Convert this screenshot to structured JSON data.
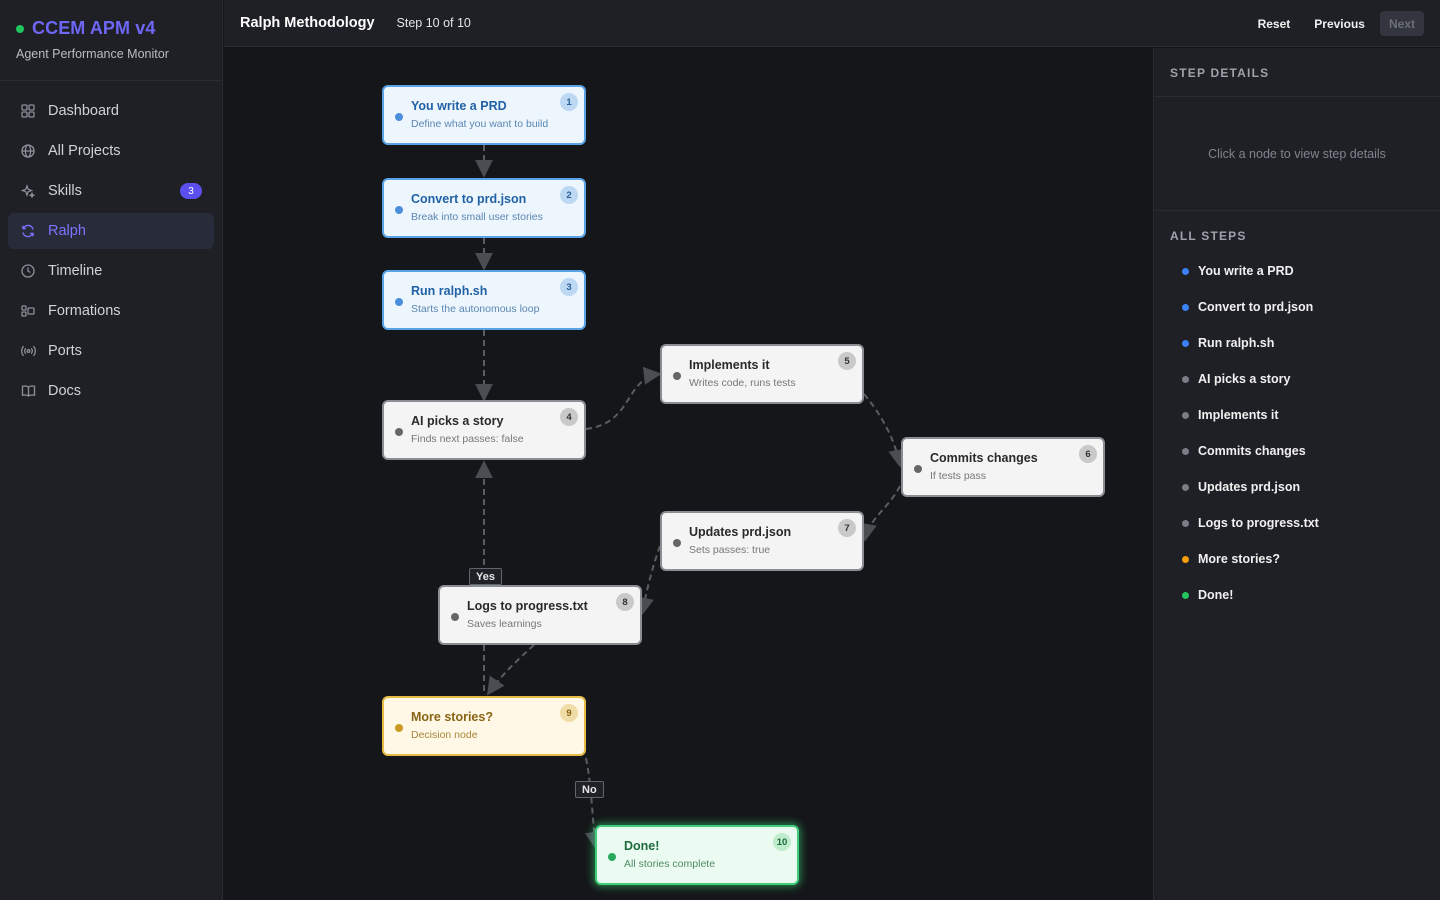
{
  "app": {
    "title": "CCEM APM v4",
    "subtitle": "Agent Performance Monitor",
    "status_color": "#22c55e"
  },
  "sidebar": {
    "items": [
      {
        "label": "Dashboard",
        "icon": "grid-icon",
        "active": false
      },
      {
        "label": "All Projects",
        "icon": "globe-icon",
        "active": false
      },
      {
        "label": "Skills",
        "icon": "sparkle-icon",
        "active": false,
        "badge": "3"
      },
      {
        "label": "Ralph",
        "icon": "refresh-icon",
        "active": true
      },
      {
        "label": "Timeline",
        "icon": "clock-icon",
        "active": false
      },
      {
        "label": "Formations",
        "icon": "formation-icon",
        "active": false
      },
      {
        "label": "Ports",
        "icon": "broadcast-icon",
        "active": false
      },
      {
        "label": "Docs",
        "icon": "book-icon",
        "active": false
      }
    ]
  },
  "header": {
    "title": "Ralph Methodology",
    "step": "Step 10 of 10",
    "reset_label": "Reset",
    "previous_label": "Previous",
    "next_label": "Next"
  },
  "flow": {
    "nodes": [
      {
        "num": "1",
        "title": "You write a PRD",
        "subtitle": "Define what you want to build",
        "variant": "blue"
      },
      {
        "num": "2",
        "title": "Convert to prd.json",
        "subtitle": "Break into small user stories",
        "variant": "blue"
      },
      {
        "num": "3",
        "title": "Run ralph.sh",
        "subtitle": "Starts the autonomous loop",
        "variant": "blue"
      },
      {
        "num": "4",
        "title": "AI picks a story",
        "subtitle": "Finds next passes: false",
        "variant": "gray"
      },
      {
        "num": "5",
        "title": "Implements it",
        "subtitle": "Writes code, runs tests",
        "variant": "gray"
      },
      {
        "num": "6",
        "title": "Commits changes",
        "subtitle": "If tests pass",
        "variant": "gray"
      },
      {
        "num": "7",
        "title": "Updates prd.json",
        "subtitle": "Sets passes: true",
        "variant": "gray"
      },
      {
        "num": "8",
        "title": "Logs to progress.txt",
        "subtitle": "Saves learnings",
        "variant": "gray"
      },
      {
        "num": "9",
        "title": "More stories?",
        "subtitle": "Decision node",
        "variant": "yellow"
      },
      {
        "num": "10",
        "title": "Done!",
        "subtitle": "All stories complete",
        "variant": "green"
      }
    ],
    "edge_labels": {
      "yes": "Yes",
      "no": "No"
    }
  },
  "panel": {
    "details_title": "STEP DETAILS",
    "details_placeholder": "Click a node to view step details",
    "steps_title": "ALL STEPS",
    "steps": [
      {
        "label": "You write a PRD",
        "color": "#3b82f6"
      },
      {
        "label": "Convert to prd.json",
        "color": "#3b82f6"
      },
      {
        "label": "Run ralph.sh",
        "color": "#3b82f6"
      },
      {
        "label": "AI picks a story",
        "color": "#7a7d85"
      },
      {
        "label": "Implements it",
        "color": "#7a7d85"
      },
      {
        "label": "Commits changes",
        "color": "#7a7d85"
      },
      {
        "label": "Updates prd.json",
        "color": "#7a7d85"
      },
      {
        "label": "Logs to progress.txt",
        "color": "#7a7d85"
      },
      {
        "label": "More stories?",
        "color": "#f59e0b"
      },
      {
        "label": "Done!",
        "color": "#22c55e"
      }
    ]
  }
}
